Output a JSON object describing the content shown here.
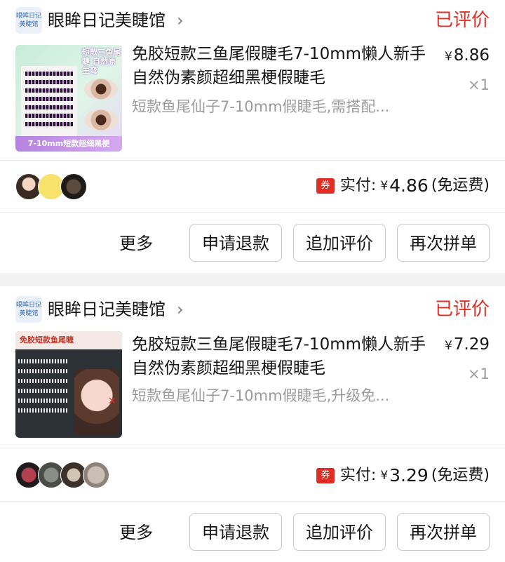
{
  "orders": [
    {
      "shop": {
        "logo_text": "眼眸日记\n美睫馆",
        "name": "眼眸日记美睫馆",
        "chevron": "›"
      },
      "status": "已评价",
      "product": {
        "thumb_title": "短款三鱼尾睫 自然原生弯",
        "thumb_band": "7-10mm短款超细黑梗",
        "title": "免胶短款三鱼尾假睫毛7-10mm懒人新手自然伪素颜超细黑梗假睫毛",
        "sku": "短款鱼尾仙子7-10mm假睫毛,需搭配...",
        "price_currency": "¥",
        "price": "8.86",
        "qty": "×1"
      },
      "payment": {
        "coupon_label": "券",
        "label": "实付:",
        "currency": "¥",
        "amount": "4.86",
        "note": "(免运费)"
      },
      "actions": {
        "more": "更多",
        "refund": "申请退款",
        "review": "追加评价",
        "regroup": "再次拼单"
      }
    },
    {
      "shop": {
        "logo_text": "眼眸日记\n美睫馆",
        "name": "眼眸日记美睫馆",
        "chevron": "›"
      },
      "status": "已评价",
      "product": {
        "thumb_title": "免胶短款鱼尾睫",
        "title": "免胶短款三鱼尾假睫毛7-10mm懒人新手自然伪素颜超细黑梗假睫毛",
        "sku": "短款鱼尾仙子7-10mm假睫毛,升级免...",
        "price_currency": "¥",
        "price": "7.29",
        "qty": "×1"
      },
      "payment": {
        "coupon_label": "券",
        "label": "实付:",
        "currency": "¥",
        "amount": "3.29",
        "note": "(免运费)"
      },
      "actions": {
        "more": "更多",
        "refund": "申请退款",
        "review": "追加评价",
        "regroup": "再次拼单"
      }
    }
  ],
  "colors": {
    "status_red": "#e02e24",
    "muted": "#9c9c9c",
    "text": "#151516",
    "page_bg": "#f2f2f2"
  }
}
